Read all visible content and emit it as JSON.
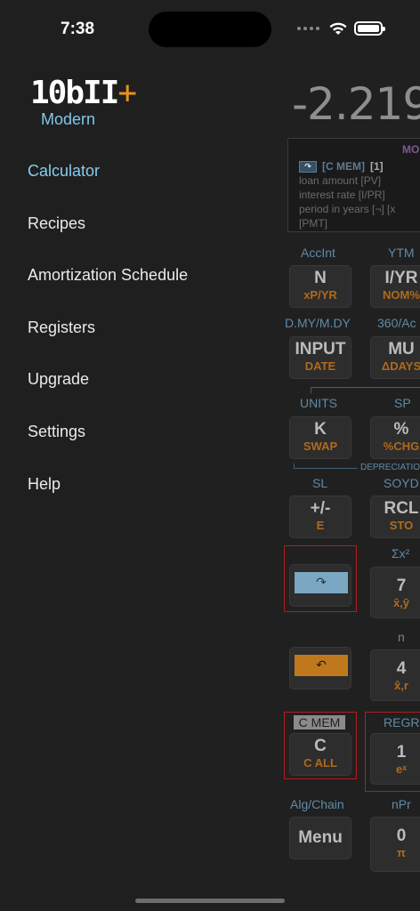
{
  "status_bar": {
    "time": "7:38"
  },
  "app": {
    "logo": "10bII",
    "logo_plus": "+",
    "logo_sub": "Modern"
  },
  "nav": {
    "items": [
      {
        "label": "Calculator",
        "active": true
      },
      {
        "label": "Recipes"
      },
      {
        "label": "Amortization Schedule"
      },
      {
        "label": "Registers"
      },
      {
        "label": "Upgrade"
      },
      {
        "label": "Settings"
      },
      {
        "label": "Help"
      }
    ]
  },
  "calculator": {
    "display": "-2.219",
    "lcd": {
      "mode": "MO",
      "header": "[C MEM]",
      "header_value": "[1]",
      "lines": [
        "loan amount   [PV]",
        "interest rate   [I/PR]",
        "period in years   [¬]  [x",
        "[PMT]"
      ]
    },
    "labels": {
      "accint": "AccInt",
      "ytm": "YTM",
      "dmy": "D.MY/M.DY",
      "ac360": "360/Ac",
      "units": "UNITS",
      "sp": "SP",
      "depreciation": "DEPRECIATION",
      "sl": "SL",
      "soyd": "SOYD",
      "sumx2": "Σx²",
      "n": "n",
      "cmem": "C MEM",
      "regr": "REGR",
      "algchain": "Alg/Chain",
      "npr": "nPr"
    },
    "keys": {
      "n": {
        "main": "N",
        "sub": "xP/YR"
      },
      "iyr": {
        "main": "I/YR",
        "sub": "NOM%"
      },
      "input": {
        "main": "INPUT",
        "sub": "DATE"
      },
      "mu": {
        "main": "MU",
        "sub": "ΔDAYS"
      },
      "k": {
        "main": "K",
        "sub": "SWAP"
      },
      "pct": {
        "main": "%",
        "sub": "%CHG"
      },
      "plusminus": {
        "main": "+/-",
        "sub": "E"
      },
      "rcl": {
        "main": "RCL",
        "sub": "STO"
      },
      "seven": {
        "main": "7",
        "sub": "x̄,ȳ"
      },
      "four": {
        "main": "4",
        "sub": "x̂,r"
      },
      "c": {
        "main": "C",
        "sub": "C ALL"
      },
      "one": {
        "main": "1",
        "sub": "eˣ"
      },
      "menu": {
        "main": "Menu"
      },
      "zero": {
        "main": "0",
        "sub": "π"
      }
    },
    "colors": {
      "blue_shift": "#7aa7c2",
      "orange_shift": "#c0781d",
      "accent": "#86ccef"
    }
  }
}
